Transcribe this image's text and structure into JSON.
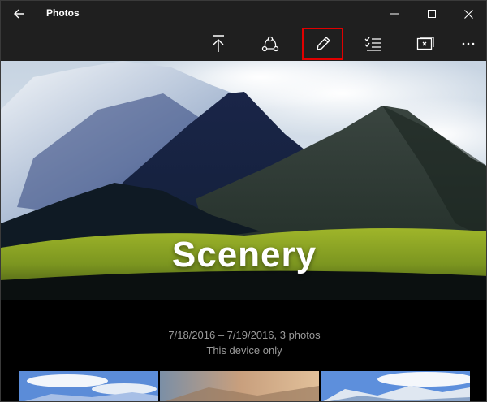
{
  "app": {
    "title": "Photos"
  },
  "titlebar": {
    "back_icon": "back-arrow-icon",
    "controls": [
      "minimize-icon",
      "maximize-icon",
      "close-icon"
    ]
  },
  "toolbar": {
    "buttons": [
      {
        "name": "share-upload-icon"
      },
      {
        "name": "share-icon"
      },
      {
        "name": "edit-pencil-icon",
        "highlighted": true
      },
      {
        "name": "select-icon"
      },
      {
        "name": "slideshow-icon"
      },
      {
        "name": "more-icon"
      }
    ],
    "highlight_color": "#e00000"
  },
  "album": {
    "title": "Scenery",
    "date_range": "7/18/2016 – 7/19/2016, 3 photos",
    "location": "This device only"
  },
  "colors": {
    "titlebar_bg": "#1f1f1f",
    "content_bg": "#000000",
    "info_text": "#9a9a9a"
  }
}
